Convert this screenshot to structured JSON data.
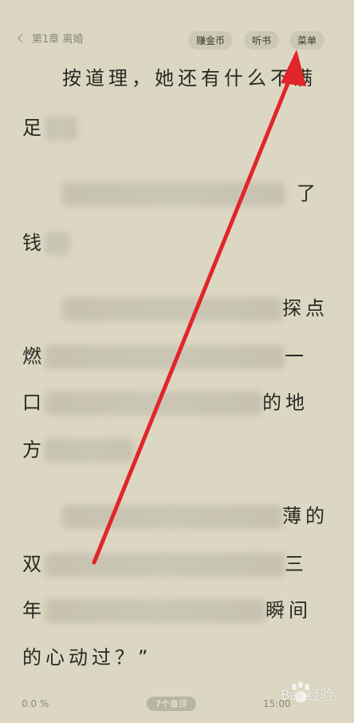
{
  "header": {
    "chapter": "第1章 离婚",
    "earn_coins": "赚金币",
    "listen": "听书",
    "menu": "菜单"
  },
  "content": {
    "l1": "按道理，她还有什么不满",
    "l2": "足",
    "l3": "了",
    "l4": "钱",
    "l5": "探点",
    "l6a": "燃",
    "l6b": "一",
    "l7a": "口",
    "l7b": "的地",
    "l8": "方",
    "l9": "薄的",
    "l10a": "双",
    "l10b": "三",
    "l11a": "年",
    "l11b": "瞬间",
    "l12": "的心动过？”"
  },
  "footer": {
    "progress": "0.0 %",
    "comments": "7个章评",
    "time": "15:00"
  },
  "watermark": "Bai 经验",
  "colors": {
    "background": "#dcd7c3",
    "arrow": "#e0262b"
  }
}
